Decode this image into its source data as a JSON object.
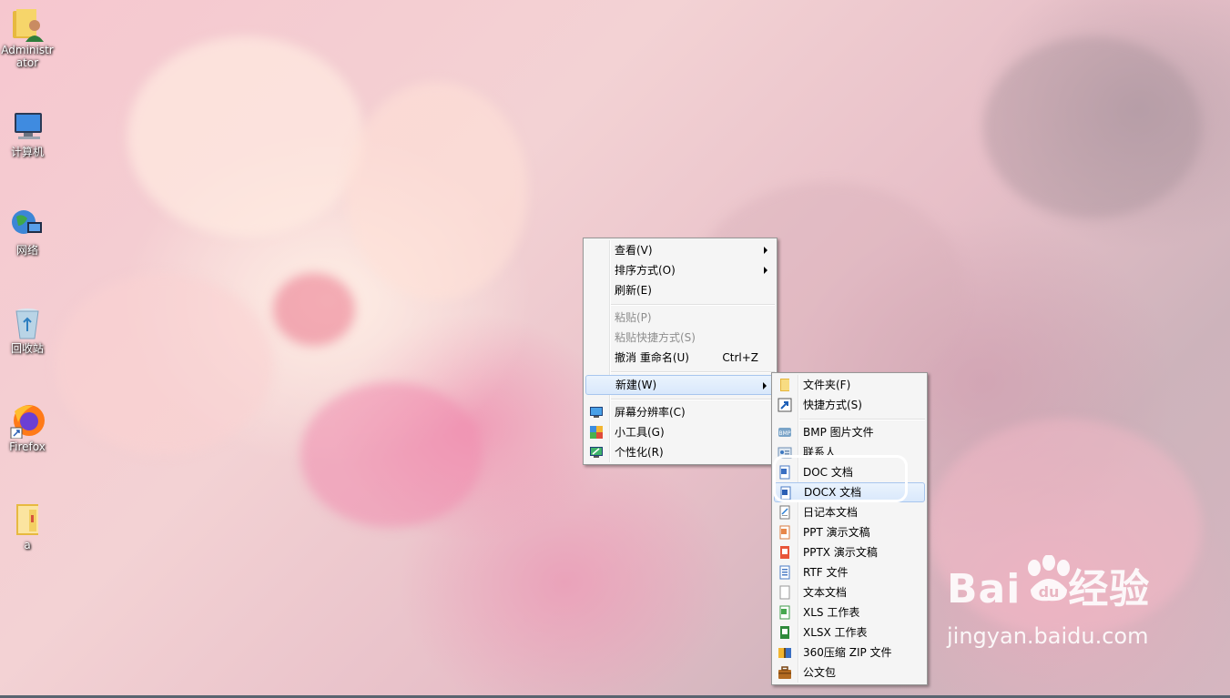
{
  "desktop_icons": [
    {
      "label": "Administrator",
      "icon": "user-folder-icon"
    },
    {
      "label": "计算机",
      "icon": "computer-icon"
    },
    {
      "label": "网络",
      "icon": "network-icon"
    },
    {
      "label": "回收站",
      "icon": "recycle-bin-icon"
    },
    {
      "label": "Firefox",
      "icon": "firefox-icon"
    },
    {
      "label": "a",
      "icon": "folder-icon"
    }
  ],
  "context_menu": {
    "items": [
      {
        "label": "查看(V)",
        "submenu": true
      },
      {
        "label": "排序方式(O)",
        "submenu": true
      },
      {
        "label": "刷新(E)"
      },
      {
        "label": "粘贴(P)",
        "disabled": true
      },
      {
        "label": "粘贴快捷方式(S)",
        "disabled": true
      },
      {
        "label": "撤消 重命名(U)",
        "shortcut": "Ctrl+Z"
      },
      {
        "label": "新建(W)",
        "submenu": true,
        "highlighted": true
      },
      {
        "label": "屏幕分辨率(C)",
        "icon": "display-icon"
      },
      {
        "label": "小工具(G)",
        "icon": "gadgets-icon"
      },
      {
        "label": "个性化(R)",
        "icon": "personalize-icon"
      }
    ]
  },
  "new_submenu": {
    "items": [
      {
        "label": "文件夹(F)",
        "icon": "folder-icon"
      },
      {
        "label": "快捷方式(S)",
        "icon": "shortcut-icon"
      },
      {
        "label": "BMP 图片文件",
        "icon": "bmp-icon"
      },
      {
        "label": "联系人",
        "icon": "contact-icon"
      },
      {
        "label": "DOC 文档",
        "icon": "doc-icon"
      },
      {
        "label": "DOCX 文档",
        "icon": "docx-icon",
        "highlighted": true
      },
      {
        "label": "日记本文档",
        "icon": "journal-icon"
      },
      {
        "label": "PPT 演示文稿",
        "icon": "ppt-icon"
      },
      {
        "label": "PPTX 演示文稿",
        "icon": "pptx-icon"
      },
      {
        "label": "RTF 文件",
        "icon": "rtf-icon"
      },
      {
        "label": "文本文档",
        "icon": "text-file-icon"
      },
      {
        "label": "XLS 工作表",
        "icon": "xls-icon"
      },
      {
        "label": "XLSX 工作表",
        "icon": "xlsx-icon"
      },
      {
        "label": "360压缩 ZIP 文件",
        "icon": "zip-icon"
      },
      {
        "label": "公文包",
        "icon": "briefcase-icon"
      }
    ]
  },
  "watermark": {
    "brand": "Bai",
    "brand_suffix": "经验",
    "url": "jingyan.baidu.com"
  },
  "colors": {
    "menu_bg": "#f5f5f5",
    "highlight_bg": "#d9e8fb",
    "highlight_border": "#a8c6ee",
    "disabled_text": "#8d8d8d"
  }
}
